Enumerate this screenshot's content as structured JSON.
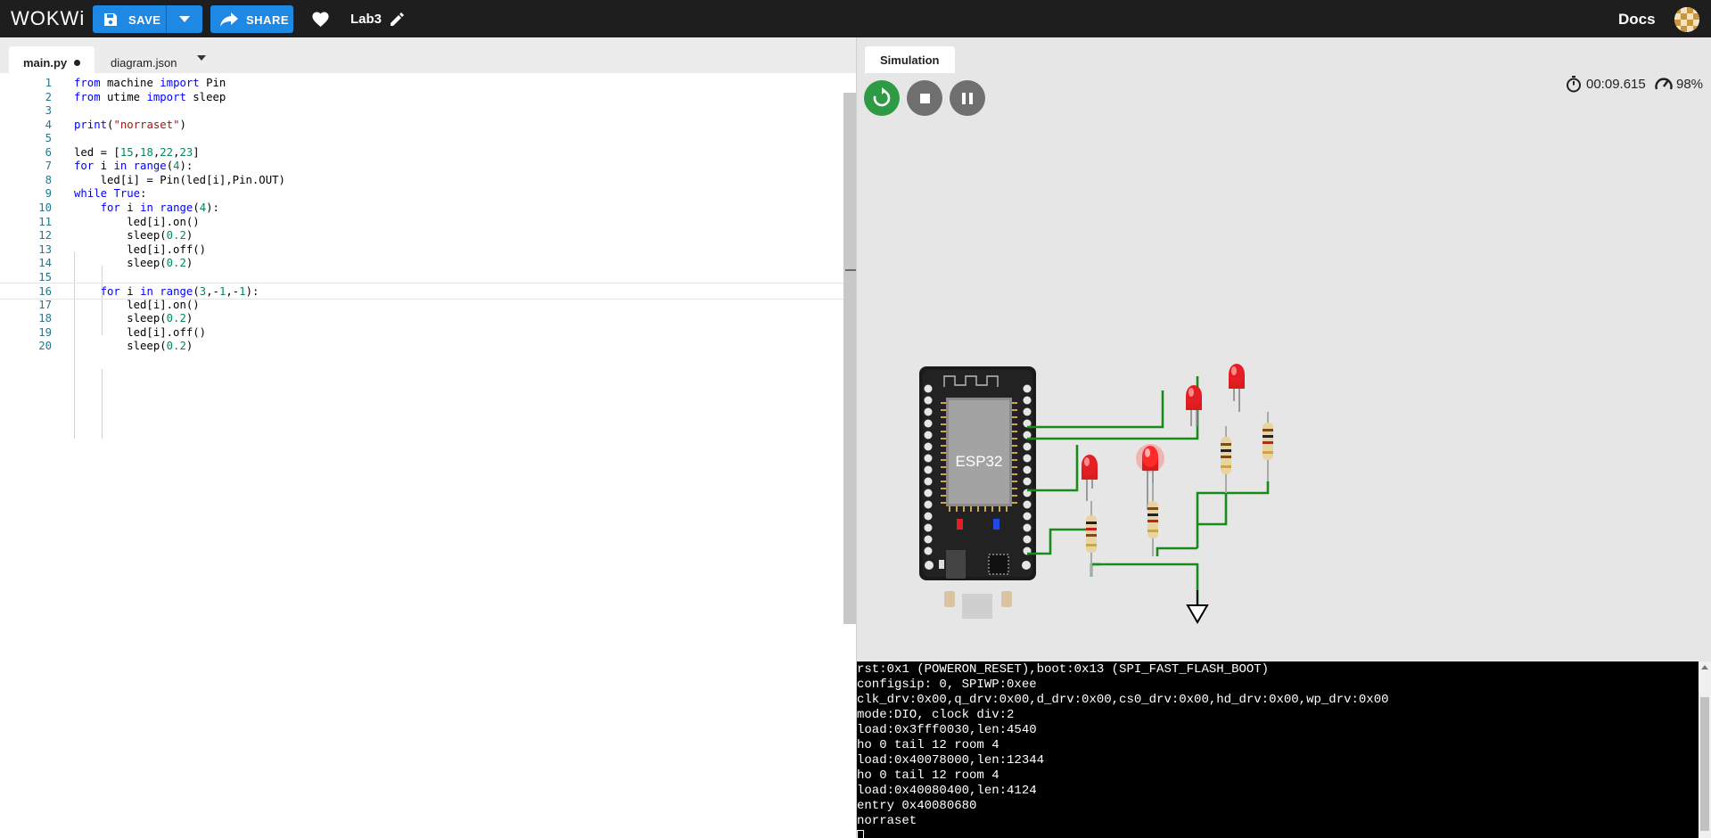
{
  "topbar": {
    "logo": "WOKWi",
    "save_label": "SAVE",
    "share_label": "SHARE",
    "project_name": "Lab3",
    "docs_label": "Docs"
  },
  "editor": {
    "tabs": [
      {
        "label": "main.py",
        "modified": true
      },
      {
        "label": "diagram.json"
      }
    ],
    "current_line": 16
  },
  "code_lines": [
    {
      "n": "1",
      "text": "from machine import Pin"
    },
    {
      "n": "2",
      "text": "from utime import sleep"
    },
    {
      "n": "3",
      "text": ""
    },
    {
      "n": "4",
      "text": "print(\"norraset\")"
    },
    {
      "n": "5",
      "text": ""
    },
    {
      "n": "6",
      "text": "led = [15,18,22,23]"
    },
    {
      "n": "7",
      "text": "for i in range(4):"
    },
    {
      "n": "8",
      "text": "    led[i] = Pin(led[i],Pin.OUT)"
    },
    {
      "n": "9",
      "text": "while True:"
    },
    {
      "n": "10",
      "text": "    for i in range(4):"
    },
    {
      "n": "11",
      "text": "        led[i].on()"
    },
    {
      "n": "12",
      "text": "        sleep(0.2)"
    },
    {
      "n": "13",
      "text": "        led[i].off()"
    },
    {
      "n": "14",
      "text": "        sleep(0.2)"
    },
    {
      "n": "15",
      "text": ""
    },
    {
      "n": "16",
      "text": "    for i in range(3,-1,-1):"
    },
    {
      "n": "17",
      "text": "        led[i].on()"
    },
    {
      "n": "18",
      "text": "        sleep(0.2)"
    },
    {
      "n": "19",
      "text": "        led[i].off()"
    },
    {
      "n": "20",
      "text": "        sleep(0.2)"
    }
  ],
  "simulation": {
    "tab_label": "Simulation",
    "timer": "00:09.615",
    "speed": "98%",
    "board_label": "ESP32",
    "colors": {
      "led": "#e31e24",
      "wire": "#1a8a1a",
      "run": "#2e9b44"
    }
  },
  "serial": {
    "lines": [
      "rst:0x1 (POWERON_RESET),boot:0x13 (SPI_FAST_FLASH_BOOT)",
      "configsip: 0, SPIWP:0xee",
      "clk_drv:0x00,q_drv:0x00,d_drv:0x00,cs0_drv:0x00,hd_drv:0x00,wp_drv:0x00",
      "mode:DIO, clock div:2",
      "load:0x3fff0030,len:4540",
      "ho 0 tail 12 room 4",
      "load:0x40078000,len:12344",
      "ho 0 tail 12 room 4",
      "load:0x40080400,len:4124",
      "entry 0x40080680",
      "norraset"
    ]
  }
}
